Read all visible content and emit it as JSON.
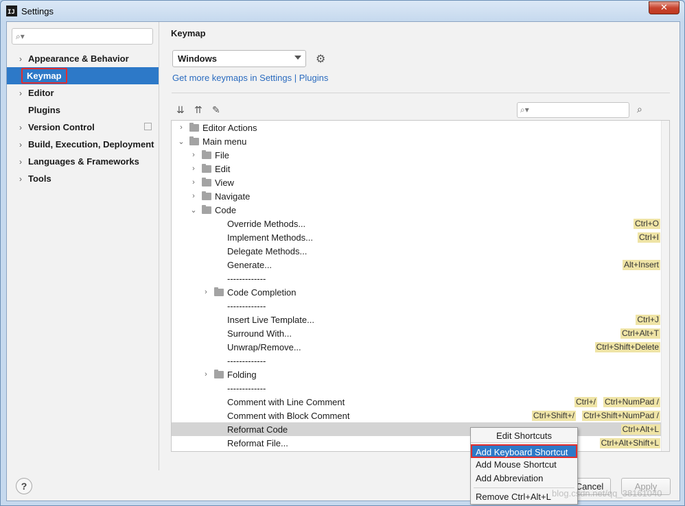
{
  "window": {
    "title": "Settings",
    "close_glyph": "✕"
  },
  "sidebar": {
    "search_placeholder": "",
    "items": [
      {
        "label": "Appearance & Behavior",
        "expandable": true
      },
      {
        "label": "Keymap",
        "expandable": false,
        "selected": true
      },
      {
        "label": "Editor",
        "expandable": true
      },
      {
        "label": "Plugins",
        "expandable": false
      },
      {
        "label": "Version Control",
        "expandable": true
      },
      {
        "label": "Build, Execution, Deployment",
        "expandable": true
      },
      {
        "label": "Languages & Frameworks",
        "expandable": true
      },
      {
        "label": "Tools",
        "expandable": true
      }
    ]
  },
  "main": {
    "heading": "Keymap",
    "keymap_value": "Windows",
    "more_link": "Get more keymaps in Settings | Plugins",
    "tree_search_placeholder": "",
    "tree": [
      {
        "depth": 0,
        "chev": "›",
        "icon": "group",
        "label": "Editor Actions"
      },
      {
        "depth": 0,
        "chev": "⌄",
        "icon": "group",
        "label": "Main menu"
      },
      {
        "depth": 1,
        "chev": "›",
        "icon": "folder",
        "label": "File"
      },
      {
        "depth": 1,
        "chev": "›",
        "icon": "folder",
        "label": "Edit"
      },
      {
        "depth": 1,
        "chev": "›",
        "icon": "folder",
        "label": "View"
      },
      {
        "depth": 1,
        "chev": "›",
        "icon": "folder",
        "label": "Navigate"
      },
      {
        "depth": 1,
        "chev": "⌄",
        "icon": "folder",
        "label": "Code"
      },
      {
        "depth": 2,
        "label": "Override Methods...",
        "shortcuts": [
          "Ctrl+O"
        ]
      },
      {
        "depth": 2,
        "label": "Implement Methods...",
        "shortcuts": [
          "Ctrl+I"
        ]
      },
      {
        "depth": 2,
        "label": "Delegate Methods..."
      },
      {
        "depth": 2,
        "label": "Generate...",
        "shortcuts": [
          "Alt+Insert"
        ]
      },
      {
        "depth": 2,
        "label": "-------------"
      },
      {
        "depth": 2,
        "chev": "›",
        "icon": "folder",
        "label": "Code Completion"
      },
      {
        "depth": 2,
        "label": "-------------"
      },
      {
        "depth": 2,
        "label": "Insert Live Template...",
        "shortcuts": [
          "Ctrl+J"
        ]
      },
      {
        "depth": 2,
        "label": "Surround With...",
        "shortcuts": [
          "Ctrl+Alt+T"
        ]
      },
      {
        "depth": 2,
        "label": "Unwrap/Remove...",
        "shortcuts": [
          "Ctrl+Shift+Delete"
        ]
      },
      {
        "depth": 2,
        "label": "-------------"
      },
      {
        "depth": 2,
        "chev": "›",
        "icon": "folder",
        "label": "Folding"
      },
      {
        "depth": 2,
        "label": "-------------"
      },
      {
        "depth": 2,
        "label": "Comment with Line Comment",
        "shortcuts": [
          "Ctrl+/",
          "Ctrl+NumPad /"
        ]
      },
      {
        "depth": 2,
        "label": "Comment with Block Comment",
        "shortcuts": [
          "Ctrl+Shift+/",
          "Ctrl+Shift+NumPad /"
        ]
      },
      {
        "depth": 2,
        "label": "Reformat Code",
        "shortcuts": [
          "Ctrl+Alt+L"
        ],
        "highlighted": true
      },
      {
        "depth": 2,
        "label": "Reformat File...",
        "shortcuts": [
          "Ctrl+Alt+Shift+L"
        ]
      }
    ]
  },
  "context_menu": {
    "title": "Edit Shortcuts",
    "items": [
      {
        "label": "Add Keyboard Shortcut",
        "active": true
      },
      {
        "label": "Add Mouse Shortcut"
      },
      {
        "label": "Add Abbreviation"
      },
      {
        "label": "Remove Ctrl+Alt+L"
      }
    ]
  },
  "footer": {
    "help": "?",
    "cancel_label": "Cancel",
    "apply_label": "Apply"
  },
  "watermark": "blog.csdn.net/qq_38161040",
  "icons": {
    "search": "search-icon",
    "gear": "gear-icon",
    "expand_all": "expand-all-icon",
    "collapse_all": "collapse-all-icon",
    "edit": "pencil-icon",
    "find_by_shortcut": "find-shortcut-icon"
  }
}
